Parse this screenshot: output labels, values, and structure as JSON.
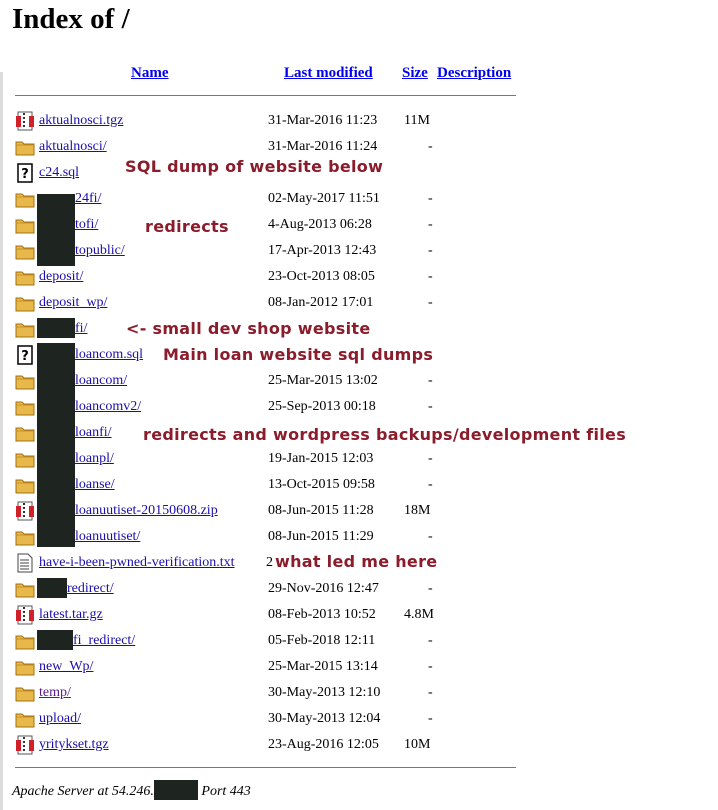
{
  "page_title": "Index of /",
  "columns": {
    "name": "Name",
    "last_modified": "Last modified",
    "size": "Size",
    "description": "Description"
  },
  "colors": {
    "link": "#1a0dab",
    "visited_link": "#551a8b",
    "annotation": "#8b1c2b",
    "redaction": "#1e241f"
  },
  "rows": [
    {
      "icon": "archive-icon",
      "name": "aktualnosci.tgz",
      "date": "31-Mar-2016 11:23",
      "size": "11M"
    },
    {
      "icon": "folder-icon",
      "name": "aktualnosci/",
      "date": "31-Mar-2016 11:24",
      "size": "-"
    },
    {
      "icon": "unknown-file-icon",
      "name": "c24.sql",
      "date": "",
      "size": ""
    },
    {
      "icon": "folder-icon",
      "name": "24fi/",
      "date": "02-May-2017 11:51",
      "size": "-"
    },
    {
      "icon": "folder-icon",
      "name": "tofi/",
      "date": "4-Aug-2013 06:28",
      "size": "-"
    },
    {
      "icon": "folder-icon",
      "name": "topublic/",
      "date": "17-Apr-2013 12:43",
      "size": "-"
    },
    {
      "icon": "folder-icon",
      "name": "deposit/",
      "date": "23-Oct-2013 08:05",
      "size": "-"
    },
    {
      "icon": "folder-icon",
      "name": "deposit_wp/",
      "date": "08-Jan-2012 17:01",
      "size": "-"
    },
    {
      "icon": "folder-icon",
      "name": "fi/",
      "date": "",
      "size": ""
    },
    {
      "icon": "unknown-file-icon",
      "name": "loancom.sql",
      "date": "",
      "size": ""
    },
    {
      "icon": "folder-icon",
      "name": "loancom/",
      "date": "25-Mar-2015 13:02",
      "size": "-"
    },
    {
      "icon": "folder-icon",
      "name": "loancomv2/",
      "date": "25-Sep-2013 00:18",
      "size": "-"
    },
    {
      "icon": "folder-icon",
      "name": "loanfi/",
      "date": "",
      "size": ""
    },
    {
      "icon": "folder-icon",
      "name": "loanpl/",
      "date": "19-Jan-2015 12:03",
      "size": "-"
    },
    {
      "icon": "folder-icon",
      "name": "loanse/",
      "date": "13-Oct-2015 09:58",
      "size": "-"
    },
    {
      "icon": "archive-icon",
      "name": "loanuutiset-20150608.zip",
      "date": "08-Jun-2015 11:28",
      "size": "18M"
    },
    {
      "icon": "folder-icon",
      "name": "loanuutiset/",
      "date": "08-Jun-2015 11:29",
      "size": "-"
    },
    {
      "icon": "text-file-icon",
      "name": "have-i-been-pwned-verification.txt",
      "date": "2",
      "size": ""
    },
    {
      "icon": "folder-icon",
      "name": "redirect/",
      "date": "29-Nov-2016 12:47",
      "size": "-"
    },
    {
      "icon": "archive-icon",
      "name": "latest.tar.gz",
      "date": "08-Feb-2013 10:52",
      "size": "4.8M"
    },
    {
      "icon": "folder-icon",
      "name": "fi_redirect/",
      "date": "05-Feb-2018 12:11",
      "size": "-"
    },
    {
      "icon": "folder-icon",
      "name": "new_Wp/",
      "date": "25-Mar-2015 13:14",
      "size": "-"
    },
    {
      "icon": "folder-icon",
      "name": "temp/",
      "date": "30-May-2013 12:10",
      "size": "-"
    },
    {
      "icon": "folder-icon",
      "name": "upload/",
      "date": "30-May-2013 12:04",
      "size": "-"
    },
    {
      "icon": "archive-icon",
      "name": "yritykset.tgz",
      "date": "23-Aug-2016 12:05",
      "size": "10M"
    }
  ],
  "annotations": {
    "sql_dump": "SQL dump of website below",
    "redirects": "redirects",
    "dev_shop": "<- small dev shop website",
    "main_loan": "Main loan website sql dumps",
    "wp_backups": "redirects and wordpress backups/development files",
    "led_here": "what led me here"
  },
  "footer": {
    "prefix": "Apache Server at 54.246.",
    "suffix": " Port 443"
  }
}
